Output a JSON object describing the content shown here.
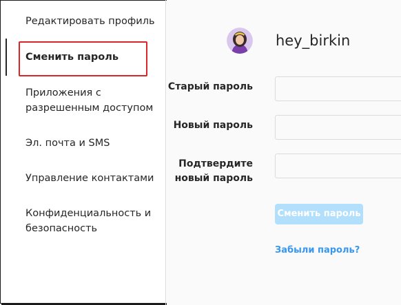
{
  "sidebar": {
    "items": [
      {
        "label": "Редактировать профиль"
      },
      {
        "label": "Сменить пароль"
      },
      {
        "label": "Приложения с разрешенным доступом"
      },
      {
        "label": "Эл. почта и SMS"
      },
      {
        "label": "Управление контактами"
      },
      {
        "label": "Конфиденциальность и безопасность"
      }
    ],
    "active_index": 1
  },
  "profile": {
    "username": "hey_birkin"
  },
  "form": {
    "old_password_label": "Старый пароль",
    "new_password_label": "Новый пароль",
    "confirm_password_label": "Подтвердите новый пароль",
    "submit_label": "Сменить пароль",
    "forgot_label": "Забыли пароль?"
  },
  "colors": {
    "accent_link": "#3897f0",
    "disabled_button": "#b2dffc",
    "highlight_box": "#d92525"
  }
}
